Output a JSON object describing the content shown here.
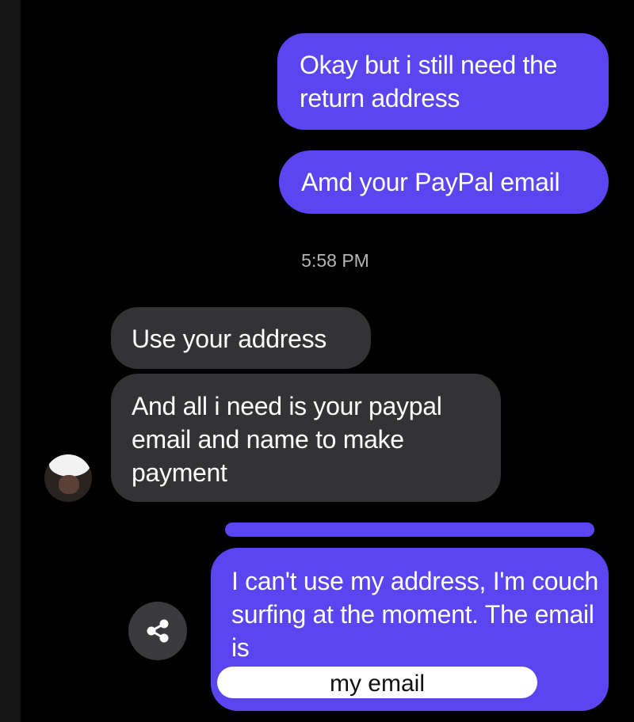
{
  "conversation": {
    "messages": [
      {
        "direction": "sent",
        "text": "Okay but i still need the return address"
      },
      {
        "direction": "sent",
        "text": "Amd your PayPal email"
      },
      {
        "direction": "received",
        "text": "Use your address"
      },
      {
        "direction": "received",
        "text": "And all i need is your paypal email and name to make payment"
      },
      {
        "direction": "sent",
        "text": "I can't use my address, I'm couch surfing at the moment. The email is"
      }
    ],
    "timestamp": "5:58 PM",
    "redaction_label": "my email"
  },
  "colors": {
    "background": "#000000",
    "sent_bubble": "#5b45f0",
    "received_bubble": "#333335",
    "share_button": "#3a3a3c"
  },
  "icons": {
    "share": "share-icon",
    "avatar": "contact-avatar"
  }
}
